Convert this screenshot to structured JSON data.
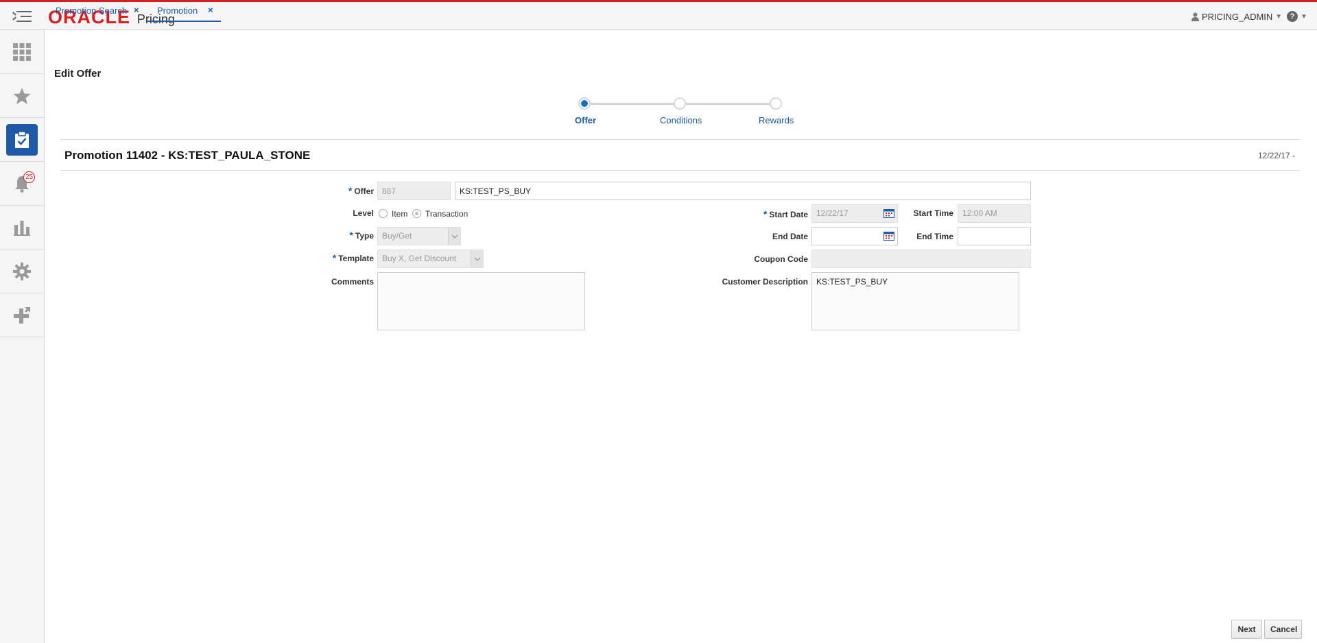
{
  "header": {
    "brand": "ORACLE",
    "product": "Pricing",
    "user": "PRICING_ADMIN",
    "accent_color": "#d71f1f",
    "link_color": "#1e5aa8"
  },
  "sidebar": {
    "items": [
      {
        "icon": "grid-icon"
      },
      {
        "icon": "star-icon"
      },
      {
        "icon": "clipboard-check-icon",
        "active": true
      },
      {
        "icon": "bell-icon",
        "badge": "25"
      },
      {
        "icon": "bar-chart-icon"
      },
      {
        "icon": "gear-icon"
      },
      {
        "icon": "plus-arrow-icon"
      }
    ]
  },
  "tabs": [
    {
      "label": "Promotion Search",
      "active": false
    },
    {
      "label": "Promotion",
      "active": true
    }
  ],
  "page": {
    "title": "Edit Offer",
    "train": [
      "Offer",
      "Conditions",
      "Rewards"
    ],
    "current_step": "Offer",
    "promotion_heading": "Promotion 11402  -  KS:TEST_PAULA_STONE",
    "promotion_date": "12/22/17 -"
  },
  "form": {
    "offer_label": "Offer",
    "offer_id": "887",
    "offer_name": "KS:TEST_PS_BUY",
    "level_label": "Level",
    "level_options": [
      "Item",
      "Transaction"
    ],
    "level_selected": "Transaction",
    "type_label": "Type",
    "type_value": "Buy/Get",
    "template_label": "Template",
    "template_value": "Buy X, Get Discount",
    "comments_label": "Comments",
    "comments_value": "",
    "start_date_label": "Start Date",
    "start_date": "12/22/17",
    "start_time_label": "Start Time",
    "start_time": "12:00 AM",
    "end_date_label": "End Date",
    "end_date": "",
    "end_time_label": "End Time",
    "end_time": "",
    "coupon_code_label": "Coupon Code",
    "coupon_code": "",
    "customer_description_label": "Customer Description",
    "customer_description": "KS:TEST_PS_BUY"
  },
  "buttons": {
    "next": "Next",
    "cancel": "Cancel"
  }
}
